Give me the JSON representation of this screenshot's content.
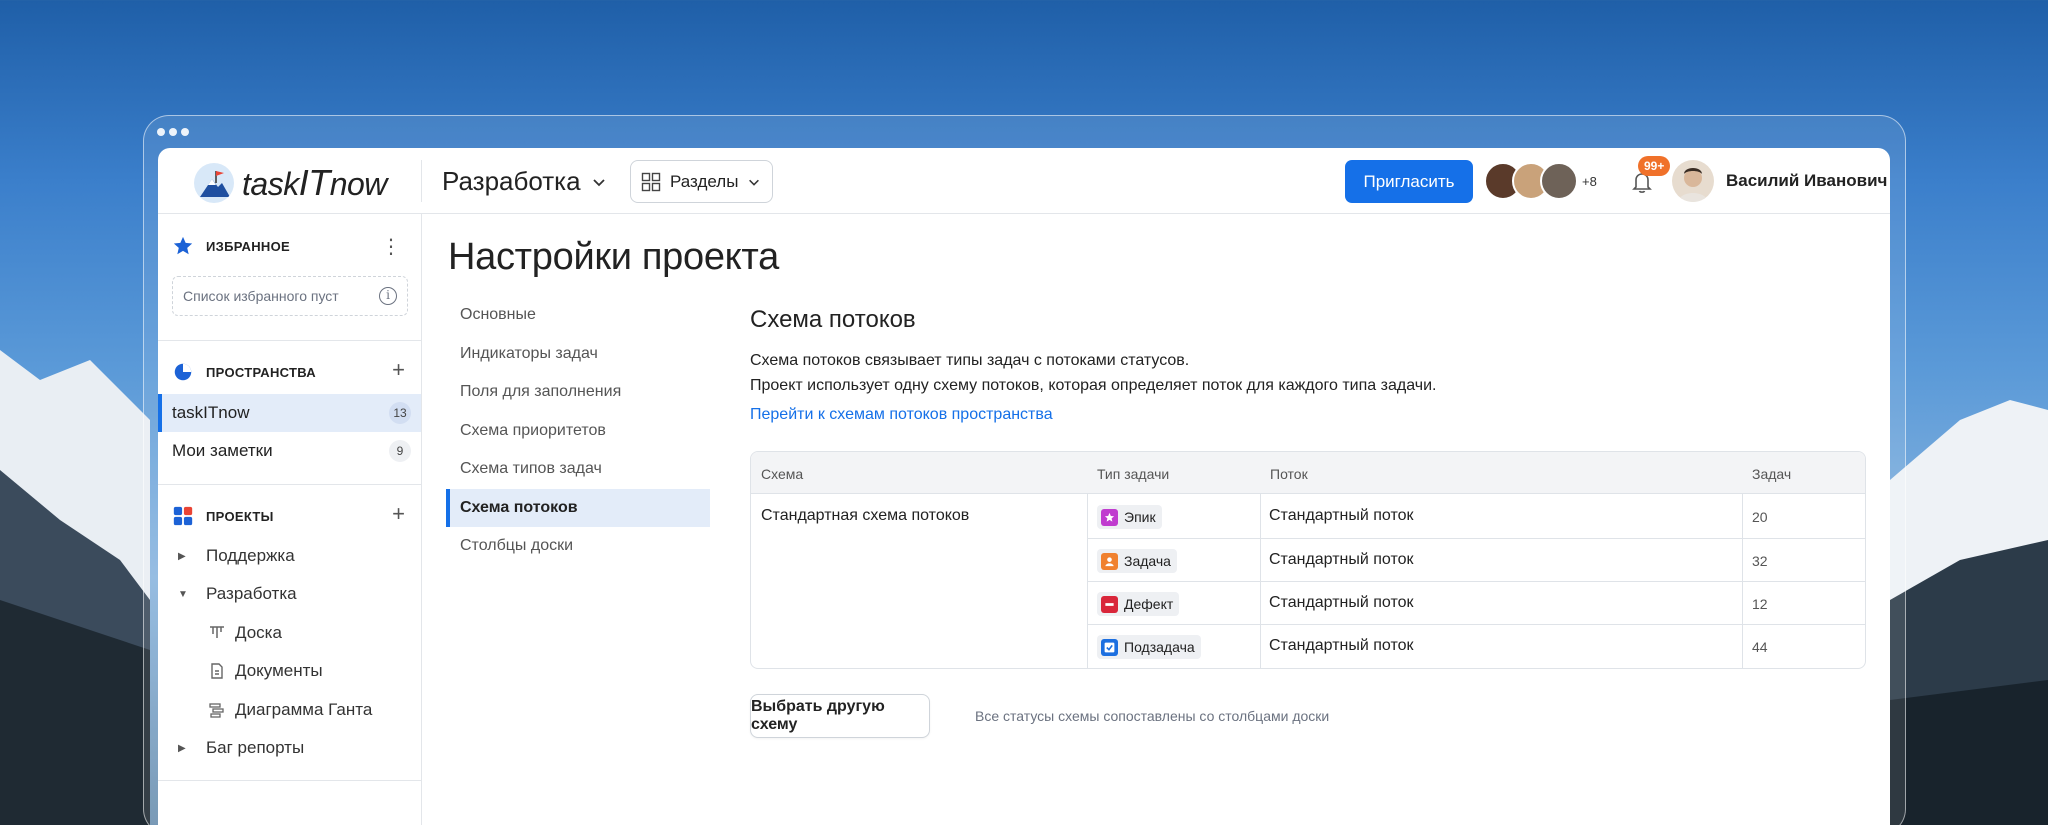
{
  "header": {
    "logo_text_a": "task",
    "logo_text_b": "IT",
    "logo_text_c": "now",
    "project": "Разработка",
    "sections_label": "Разделы",
    "invite_label": "Пригласить",
    "members_more": "+8",
    "notifications_badge": "99+",
    "user_name": "Василий Иванович"
  },
  "sidebar": {
    "favorites_title": "ИЗБРАННОЕ",
    "favorites_empty": "Список избранного пуст",
    "spaces_title": "ПРОСТРАНСТВА",
    "spaces": [
      {
        "label": "taskITnow",
        "count": "13"
      },
      {
        "label": "Мои заметки",
        "count": "9"
      }
    ],
    "projects_title": "ПРОЕКТЫ",
    "projects": [
      {
        "label": "Поддержка"
      },
      {
        "label": "Разработка"
      },
      {
        "label": "Доска"
      },
      {
        "label": "Документы"
      },
      {
        "label": "Диаграмма Ганта"
      },
      {
        "label": "Баг репорты"
      }
    ]
  },
  "main": {
    "title": "Настройки проекта",
    "subnav": [
      "Основные",
      "Индикаторы задач",
      "Поля для заполнения",
      "Схема приоритетов",
      "Схема типов задач",
      "Схема потоков",
      "Столбцы доски"
    ],
    "section_title": "Схема потоков",
    "desc_line1": "Схема потоков связывает типы задач с потоками статусов.",
    "desc_line2": "Проект использует одну схему потоков, которая определяет поток для каждого типа задачи.",
    "link": "Перейти к схемам потоков пространства",
    "table": {
      "headers": {
        "scheme": "Схема",
        "type": "Тип задачи",
        "flow": "Поток",
        "tasks": "Задач"
      },
      "scheme": "Стандартная схема потоков",
      "rows": [
        {
          "type": "Эпик",
          "flow": "Стандартный поток",
          "tasks": "20",
          "color": "#c03ccf",
          "icon": "star-icon"
        },
        {
          "type": "Задача",
          "flow": "Стандартный поток",
          "tasks": "32",
          "color": "#f0812f",
          "icon": "person-icon"
        },
        {
          "type": "Дефект",
          "flow": "Стандартный поток",
          "tasks": "12",
          "color": "#d9263a",
          "icon": "minus-icon"
        },
        {
          "type": "Подзадача",
          "flow": "Стандартный поток",
          "tasks": "44",
          "color": "#1c6fe0",
          "icon": "check-icon"
        }
      ]
    },
    "choose_button": "Выбрать другую схему",
    "hint": "Все статусы схемы сопоставлены со столбцами доски"
  },
  "colors": {
    "accent": "#1570e8",
    "badge": "#f0712a"
  }
}
